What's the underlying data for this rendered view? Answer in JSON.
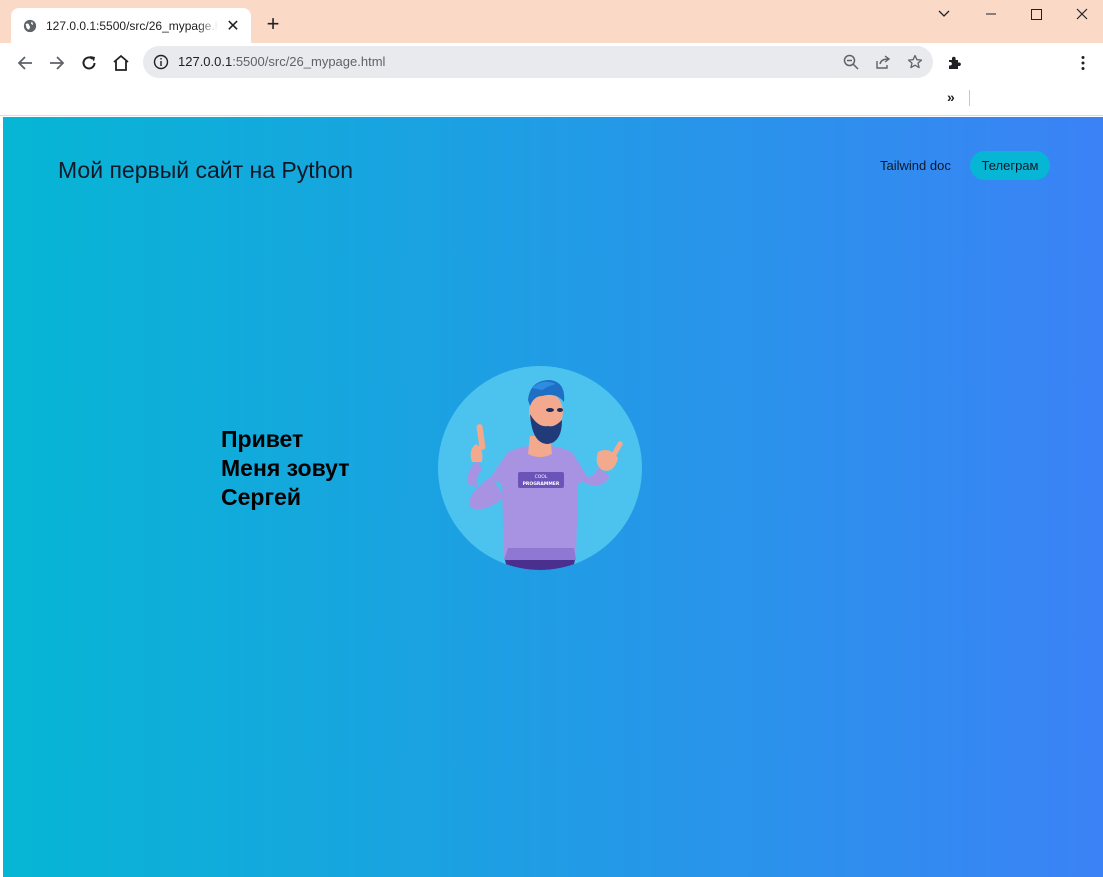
{
  "browser": {
    "tab": {
      "title": "127.0.0.1:5500/src/26_mypage.html"
    },
    "address": {
      "host": "127.0.0.1",
      "path": ":5500/src/26_mypage.html"
    },
    "bookmarks_more": "»"
  },
  "site": {
    "title": "Мой первый сайт на Python",
    "nav": {
      "link": "Tailwind doc",
      "button": "Телеграм"
    },
    "hero": {
      "line1": "Привет",
      "line2": "Меня зовут",
      "line3": "Сергей"
    },
    "avatar": {
      "shirt_text_1": "COOL",
      "shirt_text_2": "PROGRAMMER"
    }
  },
  "colors": {
    "gradient_start": "#06b6d4",
    "gradient_end": "#3b82f6",
    "pill": "#06b6d4",
    "avatar_bg": "#4cc3ef",
    "chrome_frame": "#fbd9c7"
  }
}
